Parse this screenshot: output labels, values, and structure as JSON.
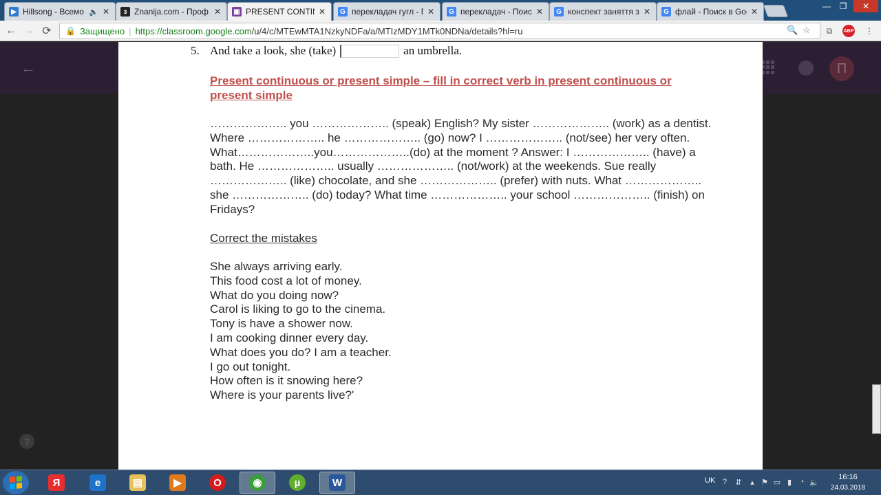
{
  "tabs": [
    {
      "title": "Hillsong - Всемо",
      "icon": "video-icon",
      "color": "#2e7bcf",
      "muted": true
    },
    {
      "title": "Znanija.com - Проф",
      "icon": "znanija-icon",
      "color": "#222222"
    },
    {
      "title": "PRESENT CONTINUO",
      "icon": "classroom-icon",
      "color": "#7b3fa0",
      "active": true
    },
    {
      "title": "перекладач гугл - Г",
      "icon": "google-icon",
      "color": "#4285f4"
    },
    {
      "title": "перекладач - Поис",
      "icon": "google-icon",
      "color": "#4285f4"
    },
    {
      "title": "конспект заняття з",
      "icon": "google-icon",
      "color": "#4285f4"
    },
    {
      "title": "флай - Поиск в Goo",
      "icon": "google-icon",
      "color": "#4285f4"
    }
  ],
  "window_controls": [
    "—",
    "❐",
    "✕"
  ],
  "toolbar": {
    "back": "←",
    "forward": "→",
    "reload": "⟳",
    "secure_label": "Защищено",
    "url_host": "https://classroom.google.com",
    "url_path": "/u/4/c/MTEwMTA1NzkyNDFa/a/MTIzMDY1MTk0NDNa/details?hl=ru",
    "abp_label": "ABP"
  },
  "document": {
    "item5_number": "5.",
    "item5_before": "And take a look, she (take)",
    "item5_after": "an umbrella.",
    "section_title": "Present continuous or present simple – fill in correct verb in present continuous or present simple",
    "exercise_text": "……………….. you ……………….. (speak) English? My sister ……………….. (work) as a dentist. Where ……………….. he ……………….. (go) now? I ……………….. (not/see) her very often. What………………..you………………..(do) at the moment ? Answer: I ……………….. (have) a bath. He ……………….. usually ……………….. (not/work) at the weekends. Sue really ……………….. (like) chocolate, and she ……………….. (prefer) with nuts. What ……………….. she ……………….. (do) today? What time ……………….. your school ……………….. (finish) on Fridays?",
    "mistakes_title": "Correct the mistakes",
    "sentences": [
      "She always arriving early.",
      "This food cost a lot of money.",
      "What do you doing now?",
      "Carol is liking to go to the cinema.",
      "Tony is have a shower now.",
      "I am cooking dinner every day.",
      "What does you do? I am a teacher.",
      "I go out tonight.",
      "How often is it snowing here?",
      "Where is your parents live?'"
    ]
  },
  "classroom": {
    "avatar_letter": "П",
    "help": "?"
  },
  "taskbar": {
    "apps": [
      {
        "name": "yandex-browser",
        "icon": "Я",
        "color": "#e62e2e"
      },
      {
        "name": "internet-explorer",
        "icon": "e",
        "color": "#1e73c8"
      },
      {
        "name": "file-explorer",
        "icon": "▤",
        "color": "#e8c15a"
      },
      {
        "name": "media-player",
        "icon": "▶",
        "color": "#e07a1f"
      },
      {
        "name": "opera",
        "icon": "O",
        "color": "#d51b1b"
      },
      {
        "name": "chrome",
        "icon": "◉",
        "color": "#3a9e3a",
        "active": true
      },
      {
        "name": "utorrent",
        "icon": "µ",
        "color": "#5fae2e"
      },
      {
        "name": "word",
        "icon": "W",
        "color": "#2b579a",
        "active": true
      }
    ],
    "language": "UK",
    "time": "16:16",
    "date": "24.03.2018"
  }
}
